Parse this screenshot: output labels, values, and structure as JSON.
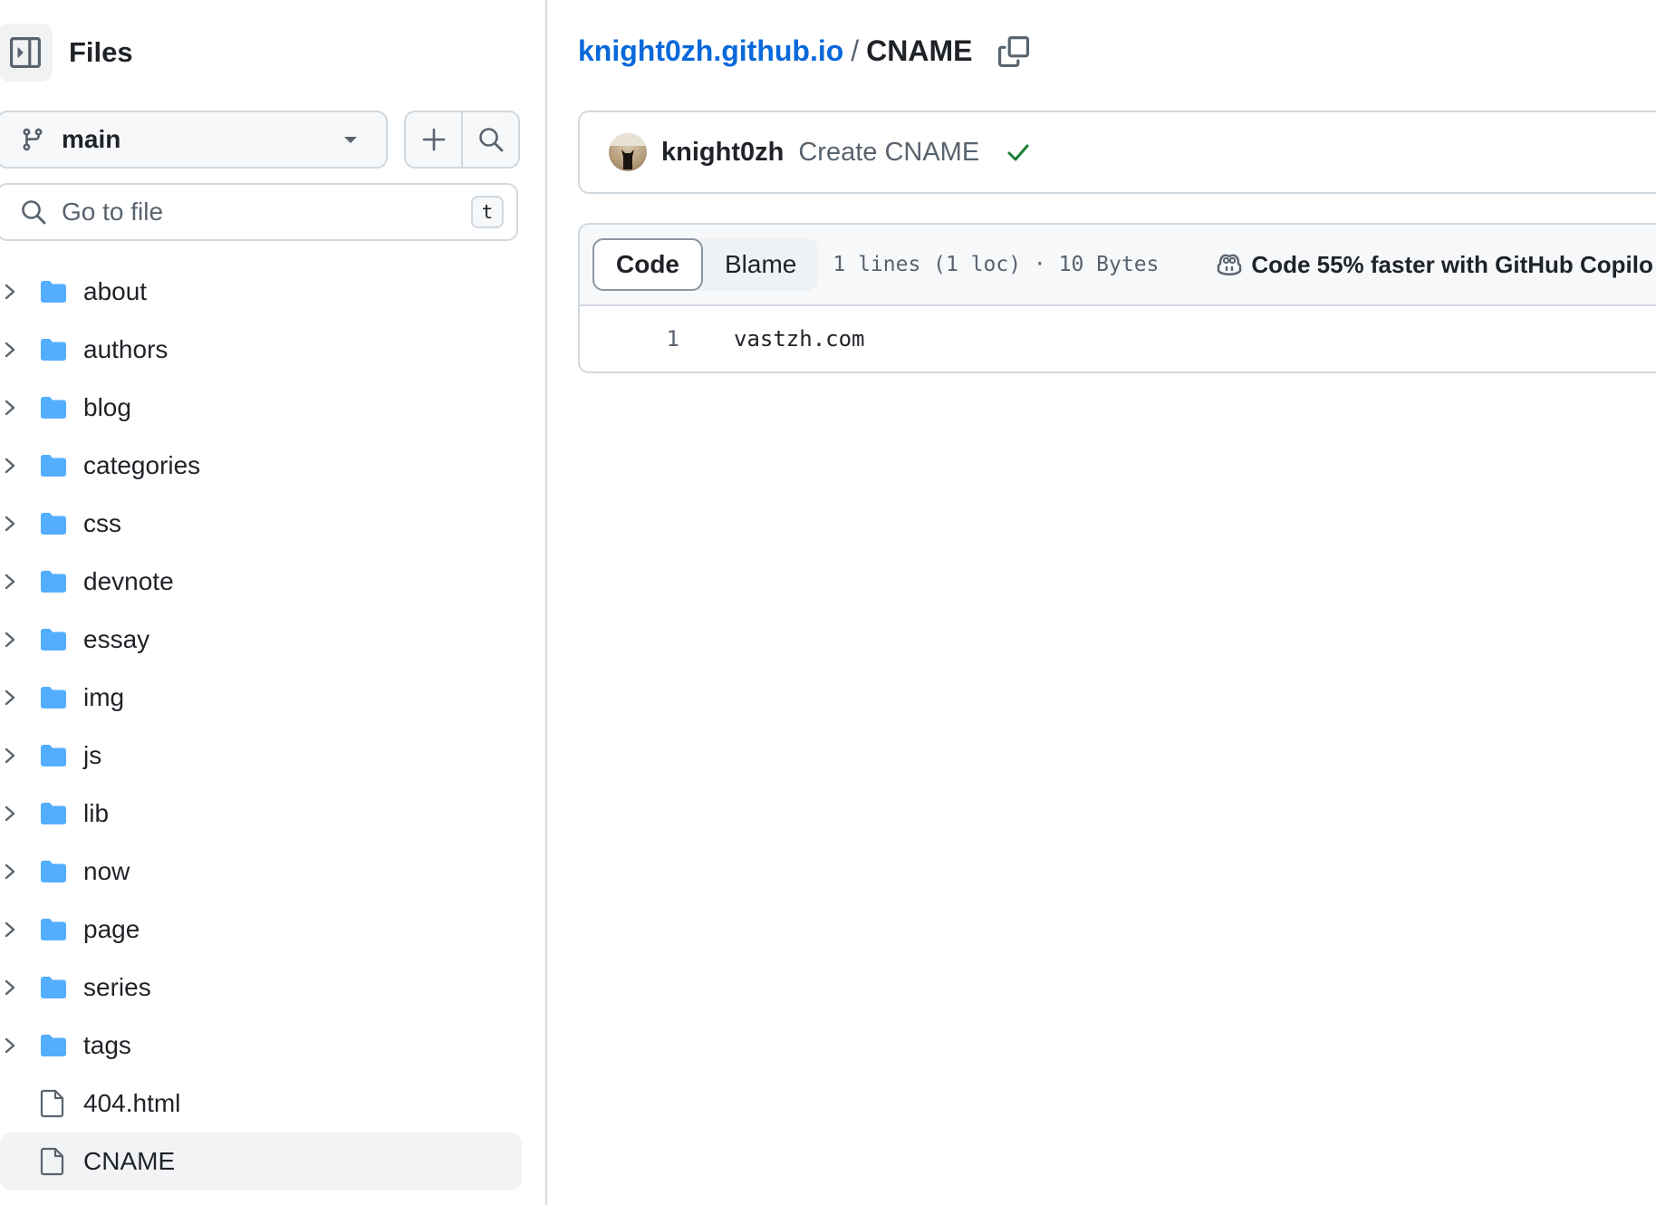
{
  "sidebar": {
    "title": "Files",
    "branch": "main",
    "goto_placeholder": "Go to file",
    "goto_shortcut": "t",
    "tree": [
      {
        "label": "about",
        "type": "folder"
      },
      {
        "label": "authors",
        "type": "folder"
      },
      {
        "label": "blog",
        "type": "folder"
      },
      {
        "label": "categories",
        "type": "folder"
      },
      {
        "label": "css",
        "type": "folder"
      },
      {
        "label": "devnote",
        "type": "folder"
      },
      {
        "label": "essay",
        "type": "folder"
      },
      {
        "label": "img",
        "type": "folder"
      },
      {
        "label": "js",
        "type": "folder"
      },
      {
        "label": "lib",
        "type": "folder"
      },
      {
        "label": "now",
        "type": "folder"
      },
      {
        "label": "page",
        "type": "folder"
      },
      {
        "label": "series",
        "type": "folder"
      },
      {
        "label": "tags",
        "type": "folder"
      },
      {
        "label": "404.html",
        "type": "file"
      },
      {
        "label": "CNAME",
        "type": "file",
        "selected": true
      }
    ]
  },
  "breadcrumb": {
    "repo": "knight0zh.github.io",
    "separator": "/",
    "file": "CNAME"
  },
  "commit": {
    "author": "knight0zh",
    "message": "Create CNAME",
    "status": "success"
  },
  "file_view": {
    "tabs": {
      "code": "Code",
      "blame": "Blame"
    },
    "active_tab": "Code",
    "meta": "1 lines (1 loc) · 10 Bytes",
    "copilot_text": "Code 55% faster with GitHub Copilo",
    "lines": [
      {
        "number": "1",
        "text": "vastzh.com"
      }
    ]
  },
  "colors": {
    "link": "#0969da",
    "folder": "#54aeff",
    "success": "#1a7f37",
    "border": "#d1d9e0"
  }
}
